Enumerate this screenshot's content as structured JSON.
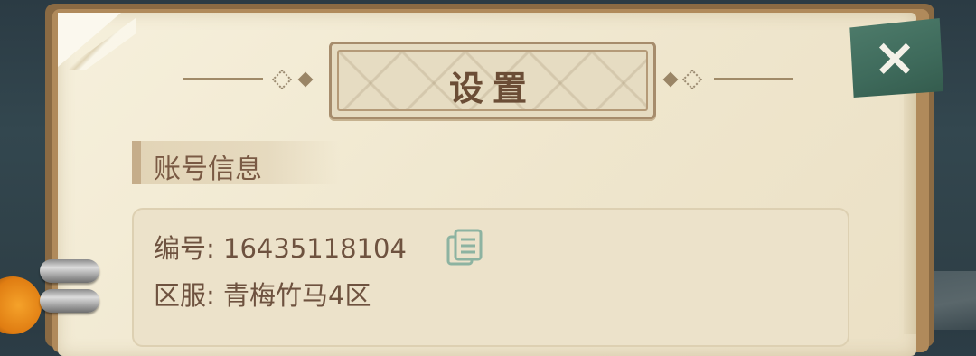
{
  "dialog": {
    "title": "设置",
    "close_label": "×"
  },
  "account_section": {
    "title": "账号信息",
    "id_label": "编号: ",
    "id_value": "16435118104",
    "server_label": "区服: ",
    "server_value": "青梅竹马4区"
  },
  "icons": {
    "close": "close-icon",
    "copy": "copy-icon"
  },
  "colors": {
    "paper": "#f2eacf",
    "title_text": "#6b4d36",
    "close_button": "#3f6b5c",
    "text": "#6e523f"
  }
}
